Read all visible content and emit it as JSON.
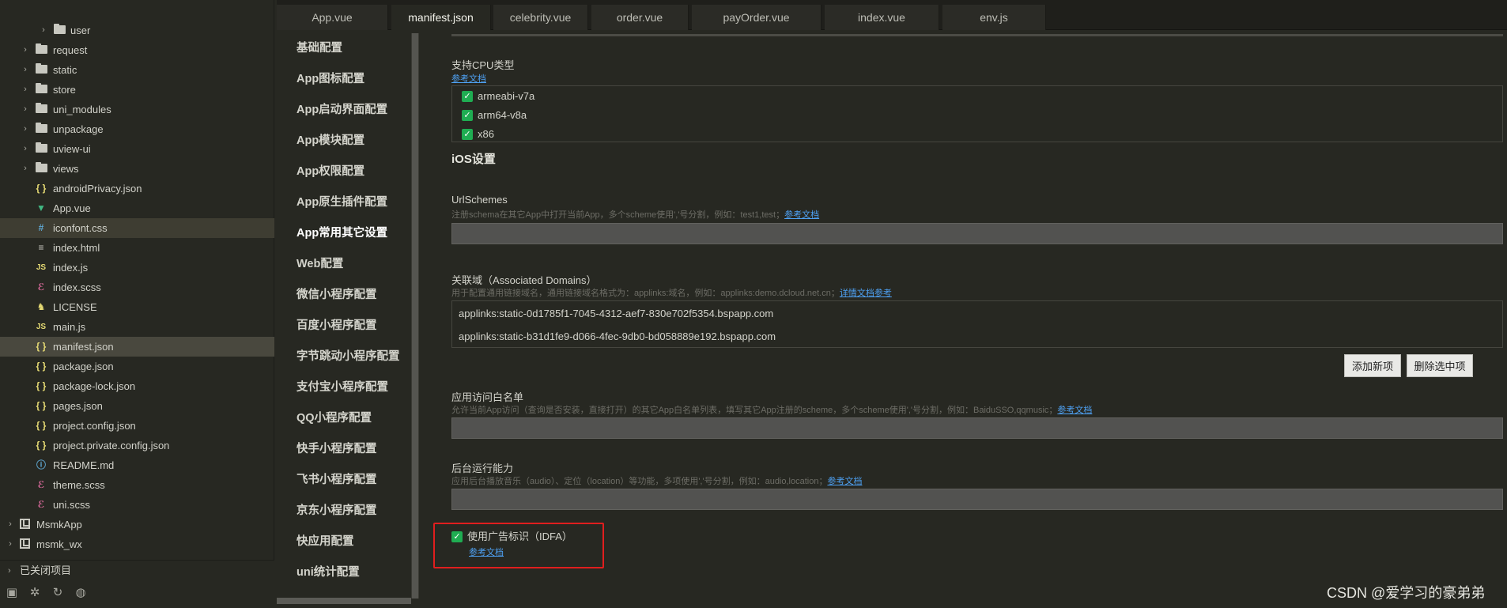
{
  "tree": {
    "items": [
      {
        "label": "user",
        "icon": "folder",
        "arrow": "›",
        "depth": 2,
        "state": "normal"
      },
      {
        "label": "request",
        "icon": "folder",
        "arrow": "›",
        "depth": 1,
        "state": "normal"
      },
      {
        "label": "static",
        "icon": "folder",
        "arrow": "›",
        "depth": 1,
        "state": "normal"
      },
      {
        "label": "store",
        "icon": "folder",
        "arrow": "›",
        "depth": 1,
        "state": "normal"
      },
      {
        "label": "uni_modules",
        "icon": "folder",
        "arrow": "›",
        "depth": 1,
        "state": "normal"
      },
      {
        "label": "unpackage",
        "icon": "folder",
        "arrow": "›",
        "depth": 1,
        "state": "normal"
      },
      {
        "label": "uview-ui",
        "icon": "folder",
        "arrow": "›",
        "depth": 1,
        "state": "normal"
      },
      {
        "label": "views",
        "icon": "folder",
        "arrow": "›",
        "depth": 1,
        "state": "normal"
      },
      {
        "label": "androidPrivacy.json",
        "icon": "json",
        "glyph": "{ }",
        "color": "#e6db74",
        "depth": 1,
        "state": "normal"
      },
      {
        "label": "App.vue",
        "icon": "vue",
        "glyph": "▼",
        "color": "#41b883",
        "depth": 1,
        "state": "normal"
      },
      {
        "label": "iconfont.css",
        "icon": "css",
        "glyph": "#",
        "color": "#5fa8d3",
        "depth": 1,
        "state": "hl"
      },
      {
        "label": "index.html",
        "icon": "html",
        "glyph": "≡",
        "color": "#c8c8c0",
        "depth": 1,
        "state": "normal"
      },
      {
        "label": "index.js",
        "icon": "js",
        "glyph": "JS",
        "color": "#e6db74",
        "depth": 1,
        "state": "normal"
      },
      {
        "label": "index.scss",
        "icon": "scss",
        "glyph": "ℰ",
        "color": "#e06c9f",
        "depth": 1,
        "state": "normal"
      },
      {
        "label": "LICENSE",
        "icon": "license",
        "glyph": "♞",
        "color": "#e6db74",
        "depth": 1,
        "state": "normal"
      },
      {
        "label": "main.js",
        "icon": "js",
        "glyph": "JS",
        "color": "#e6db74",
        "depth": 1,
        "state": "normal"
      },
      {
        "label": "manifest.json",
        "icon": "json",
        "glyph": "{ }",
        "color": "#e6db74",
        "depth": 1,
        "state": "sel"
      },
      {
        "label": "package.json",
        "icon": "json",
        "glyph": "{ }",
        "color": "#e6db74",
        "depth": 1,
        "state": "normal"
      },
      {
        "label": "package-lock.json",
        "icon": "json",
        "glyph": "{ }",
        "color": "#e6db74",
        "depth": 1,
        "state": "normal"
      },
      {
        "label": "pages.json",
        "icon": "json",
        "glyph": "{ }",
        "color": "#e6db74",
        "depth": 1,
        "state": "normal"
      },
      {
        "label": "project.config.json",
        "icon": "json",
        "glyph": "{ }",
        "color": "#e6db74",
        "depth": 1,
        "state": "normal"
      },
      {
        "label": "project.private.config.json",
        "icon": "json",
        "glyph": "{ }",
        "color": "#e6db74",
        "depth": 1,
        "state": "normal"
      },
      {
        "label": "README.md",
        "icon": "info",
        "glyph": "ⓘ",
        "color": "#5fa8d3",
        "depth": 1,
        "state": "normal"
      },
      {
        "label": "theme.scss",
        "icon": "scss",
        "glyph": "ℰ",
        "color": "#e06c9f",
        "depth": 1,
        "state": "normal"
      },
      {
        "label": "uni.scss",
        "icon": "scss",
        "glyph": "ℰ",
        "color": "#e06c9f",
        "depth": 1,
        "state": "normal"
      },
      {
        "label": "MsmkApp",
        "icon": "project",
        "arrow": "›",
        "depth": 0,
        "state": "normal"
      },
      {
        "label": "msmk_wx",
        "icon": "project",
        "arrow": "›",
        "depth": 0,
        "state": "normal"
      }
    ],
    "closed_projects": "已关闭项目",
    "tools": [
      "file-icon",
      "bug-icon",
      "sync-icon",
      "globe-icon"
    ]
  },
  "tabs": [
    "App.vue",
    "manifest.json",
    "celebrity.vue",
    "order.vue",
    "payOrder.vue",
    "index.vue",
    "env.js"
  ],
  "active_tab": "manifest.json",
  "nav": {
    "items": [
      "基础配置",
      "App图标配置",
      "App启动界面配置",
      "App模块配置",
      "App权限配置",
      "App原生插件配置",
      "App常用其它设置",
      "Web配置",
      "微信小程序配置",
      "百度小程序配置",
      "字节跳动小程序配置",
      "支付宝小程序配置",
      "QQ小程序配置",
      "快手小程序配置",
      "飞书小程序配置",
      "京东小程序配置",
      "快应用配置",
      "uni统计配置"
    ],
    "active": "App常用其它设置"
  },
  "form": {
    "cpu": {
      "label": "支持CPU类型",
      "link": "参考文档",
      "options": [
        "armeabi-v7a",
        "arm64-v8a",
        "x86"
      ],
      "checked": [
        true,
        true,
        true
      ]
    },
    "ios_section": "iOS设置",
    "url_schemes": {
      "label": "UrlSchemes",
      "hint": "注册schema在其它App中打开当前App，多个scheme使用','号分割，例如：test1,test；",
      "link": "参考文档",
      "value": ""
    },
    "domains": {
      "label": "关联域（Associated Domains）",
      "hint": "用于配置通用链接域名，通用链接域名格式为：applinks:域名，例如：applinks:demo.dcloud.net.cn；",
      "link": "详情文档参考",
      "values": [
        "applinks:static-0d1785f1-7045-4312-aef7-830e702f5354.bspapp.com",
        "applinks:static-b31d1fe9-d066-4fec-9db0-bd058889e192.bspapp.com"
      ],
      "add_button": "添加新项",
      "delete_button": "删除选中项"
    },
    "whitelist": {
      "label": "应用访问白名单",
      "hint": "允许当前App访问（查询是否安装，直接打开）的其它App白名单列表，填写其它App注册的scheme，多个scheme使用','号分割，例如：BaiduSSO,qqmusic；",
      "link": "参考文档",
      "value": ""
    },
    "background": {
      "label": "后台运行能力",
      "hint": "应用后台播放音乐（audio）、定位（location）等功能，多项使用','号分割，例如：audio,location；",
      "link": "参考文档",
      "value": ""
    },
    "idfa": {
      "label": "使用广告标识（IDFA）",
      "link": "参考文档",
      "checked": true
    }
  },
  "watermark": "CSDN @爱学习的豪弟弟",
  "colors": {
    "accent_link": "#4ea1f3",
    "checkbox": "#1fad52",
    "highlight_box": "#e01e1e",
    "selected_row": "#49483e"
  }
}
